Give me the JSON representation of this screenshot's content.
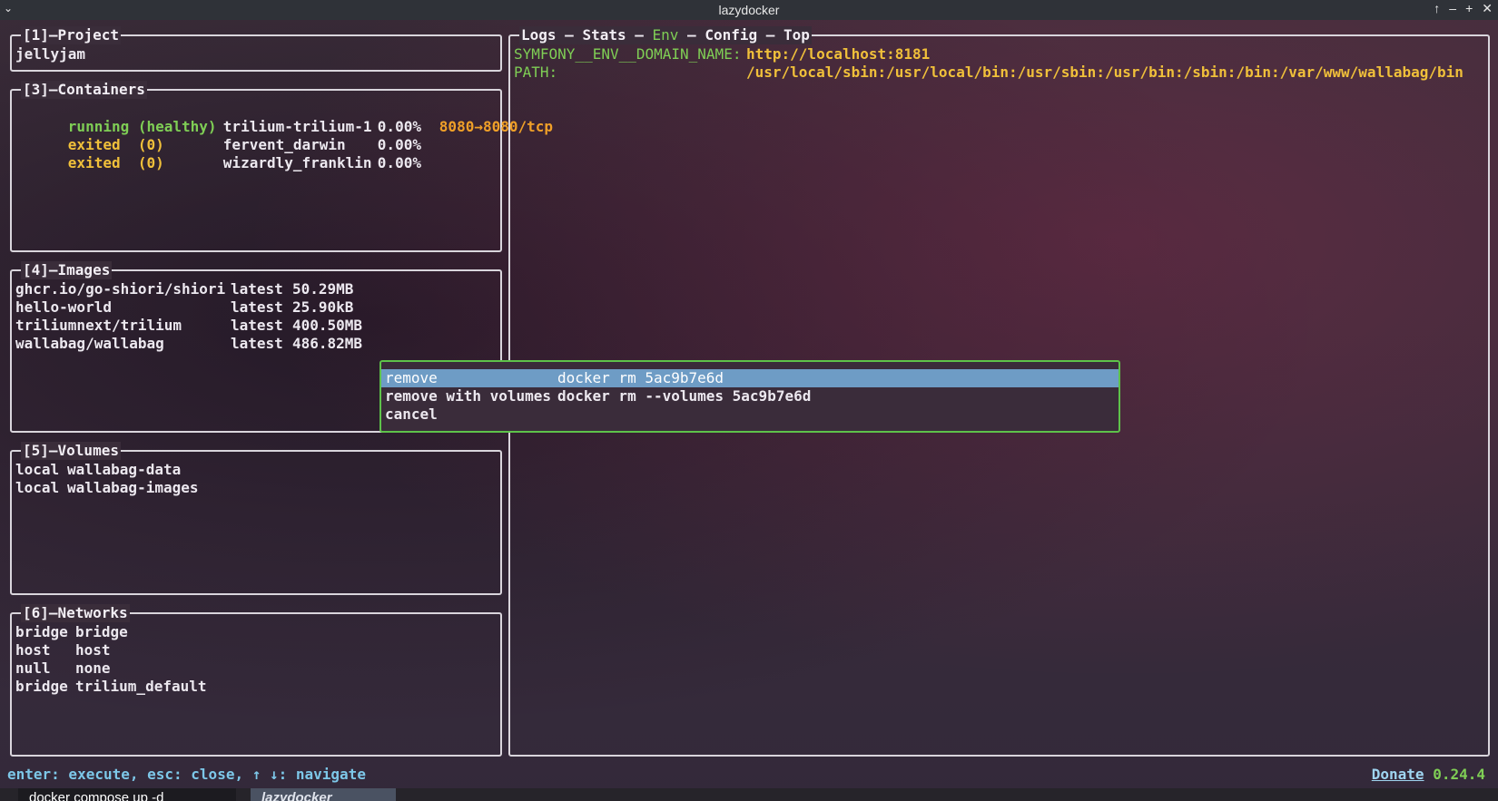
{
  "window": {
    "title": "lazydocker",
    "menu_icon": "chevron-down-icon",
    "controls": [
      "↑",
      "–",
      "+",
      "✕"
    ]
  },
  "panels": {
    "project": {
      "title": "[1]–Project",
      "items": [
        "jellyjam"
      ]
    },
    "containers": {
      "title": "[3]–Containers",
      "rows": [
        {
          "status": "running (healthy)",
          "name": "trilium-trilium-1",
          "cpu": "0.00%",
          "ports": "8080→8080/tcp"
        },
        {
          "status": "exited  (0)",
          "name": "fervent_darwin",
          "cpu": "0.00%",
          "ports": ""
        },
        {
          "status": "exited  (0)",
          "name": "wizardly_franklin",
          "cpu": "0.00%",
          "ports": ""
        }
      ]
    },
    "images": {
      "title": "[4]–Images",
      "rows": [
        {
          "name": "ghcr.io/go-shiori/shiori",
          "tag": "latest",
          "size": "50.29MB"
        },
        {
          "name": "hello-world",
          "tag": "latest",
          "size": "25.90kB"
        },
        {
          "name": "triliumnext/trilium",
          "tag": "latest",
          "size": "400.50MB"
        },
        {
          "name": "wallabag/wallabag",
          "tag": "latest",
          "size": "486.82MB"
        }
      ]
    },
    "volumes": {
      "title": "[5]–Volumes",
      "rows": [
        {
          "driver": "local",
          "name": "wallabag-data"
        },
        {
          "driver": "local",
          "name": "wallabag-images"
        }
      ]
    },
    "networks": {
      "title": "[6]–Networks",
      "rows": [
        {
          "driver": "bridge",
          "name": "bridge"
        },
        {
          "driver": "host",
          "name": "host"
        },
        {
          "driver": "null",
          "name": "none"
        },
        {
          "driver": "bridge",
          "name": "trilium_default"
        }
      ]
    }
  },
  "main": {
    "tabs": [
      "Logs",
      "Stats",
      "Env",
      "Config",
      "Top"
    ],
    "active_tab": "Env",
    "separator": " – ",
    "env": [
      {
        "key": "SYMFONY__ENV__DOMAIN_NAME:",
        "value": "http://localhost:8181"
      },
      {
        "key": "PATH:",
        "value": "/usr/local/sbin:/usr/local/bin:/usr/sbin:/usr/bin:/sbin:/bin:/var/www/wallabag/bin"
      }
    ]
  },
  "menu": {
    "items": [
      {
        "label": "remove",
        "command": "docker rm 5ac9b7e6d"
      },
      {
        "label": "remove with volumes",
        "command": "docker rm --volumes 5ac9b7e6d"
      },
      {
        "label": "cancel",
        "command": ""
      }
    ],
    "selected_index": 0
  },
  "status": {
    "hint": "enter: execute, esc: close, ↑ ↓: navigate",
    "donate": "Donate",
    "version": "0.24.4"
  },
  "taskbar": {
    "tabs": [
      "docker compose up -d",
      "lazydocker"
    ]
  },
  "colors": {
    "running": "#7fce55",
    "exited": "#f0c03a",
    "ports": "#f0a028",
    "selection": "#6e9cc5",
    "popup_border": "#5ec24a",
    "hint": "#7dc7e8"
  }
}
